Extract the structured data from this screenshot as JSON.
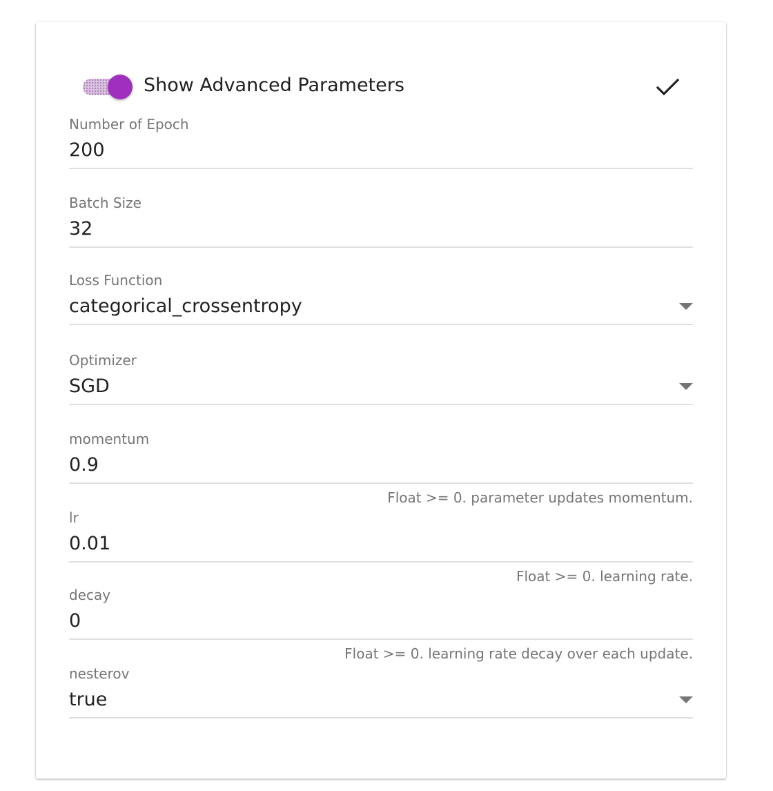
{
  "header": {
    "toggle_label": "Show Advanced Parameters",
    "toggle_on": true,
    "accent_color": "#a12fbd",
    "confirm_icon": "check-icon"
  },
  "fields": {
    "epochs": {
      "label": "Number of Epoch",
      "value": "200"
    },
    "batch_size": {
      "label": "Batch Size",
      "value": "32"
    },
    "loss": {
      "label": "Loss Function",
      "value": "categorical_crossentropy",
      "icon": "dropdown-arrow-icon"
    },
    "optimizer": {
      "label": "Optimizer",
      "value": "SGD",
      "icon": "dropdown-arrow-icon"
    },
    "momentum": {
      "label": "momentum",
      "value": "0.9",
      "helper": "Float >= 0. parameter updates momentum."
    },
    "lr": {
      "label": "lr",
      "value": "0.01",
      "helper": "Float >= 0. learning rate."
    },
    "decay": {
      "label": "decay",
      "value": "0",
      "helper": "Float >= 0. learning rate decay over each update."
    },
    "nesterov": {
      "label": "nesterov",
      "value": "true",
      "icon": "dropdown-arrow-icon"
    }
  }
}
